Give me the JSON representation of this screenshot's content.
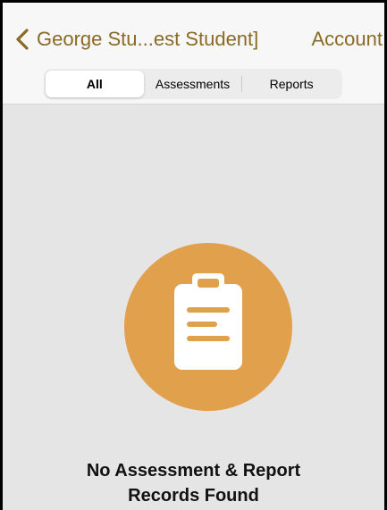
{
  "header": {
    "back_title": "George Stu...est Student]",
    "account_label": "Account"
  },
  "tabs": [
    {
      "label": "All",
      "selected": true
    },
    {
      "label": "Assessments",
      "selected": false
    },
    {
      "label": "Reports",
      "selected": false
    }
  ],
  "empty_state": {
    "icon": "clipboard-icon",
    "line1": "No Assessment & Report",
    "line2": "Records Found"
  },
  "colors": {
    "accent": "#8a6a25",
    "icon_circle": "#e1a04b",
    "background": "#e5e5e5"
  }
}
